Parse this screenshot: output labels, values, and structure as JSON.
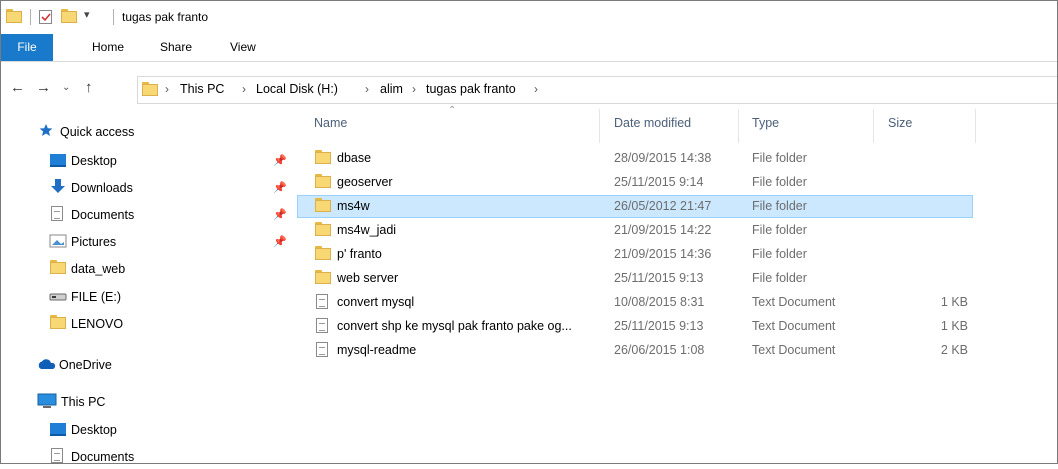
{
  "window": {
    "title": "tugas pak franto"
  },
  "ribbon": {
    "tabs": [
      "File",
      "Home",
      "Share",
      "View"
    ]
  },
  "address": {
    "crumbs": [
      "This PC",
      "Local Disk (H:)",
      "alim",
      "tugas pak franto"
    ]
  },
  "nav": {
    "quick_access": "Quick access",
    "quick_items": [
      "Desktop",
      "Downloads",
      "Documents",
      "Pictures",
      "data_web",
      "FILE (E:)",
      "LENOVO"
    ],
    "onedrive": "OneDrive",
    "this_pc": "This PC",
    "pc_items": [
      "Desktop",
      "Documents"
    ]
  },
  "columns": {
    "name": "Name",
    "date": "Date modified",
    "type": "Type",
    "size": "Size"
  },
  "files": [
    {
      "name": "dbase",
      "date": "28/09/2015 14:38",
      "type": "File folder",
      "size": ""
    },
    {
      "name": "geoserver",
      "date": "25/11/2015 9:14",
      "type": "File folder",
      "size": ""
    },
    {
      "name": "ms4w",
      "date": "26/05/2012 21:47",
      "type": "File folder",
      "size": ""
    },
    {
      "name": "ms4w_jadi",
      "date": "21/09/2015 14:22",
      "type": "File folder",
      "size": ""
    },
    {
      "name": "p' franto",
      "date": "21/09/2015 14:36",
      "type": "File folder",
      "size": ""
    },
    {
      "name": "web server",
      "date": "25/11/2015 9:13",
      "type": "File folder",
      "size": ""
    },
    {
      "name": "convert mysql",
      "date": "10/08/2015 8:31",
      "type": "Text Document",
      "size": "1 KB"
    },
    {
      "name": "convert shp ke mysql pak franto pake og...",
      "date": "25/11/2015 9:13",
      "type": "Text Document",
      "size": "1 KB"
    },
    {
      "name": "mysql-readme",
      "date": "26/06/2015 1:08",
      "type": "Text Document",
      "size": "2 KB"
    }
  ],
  "selected_file": "ms4w"
}
